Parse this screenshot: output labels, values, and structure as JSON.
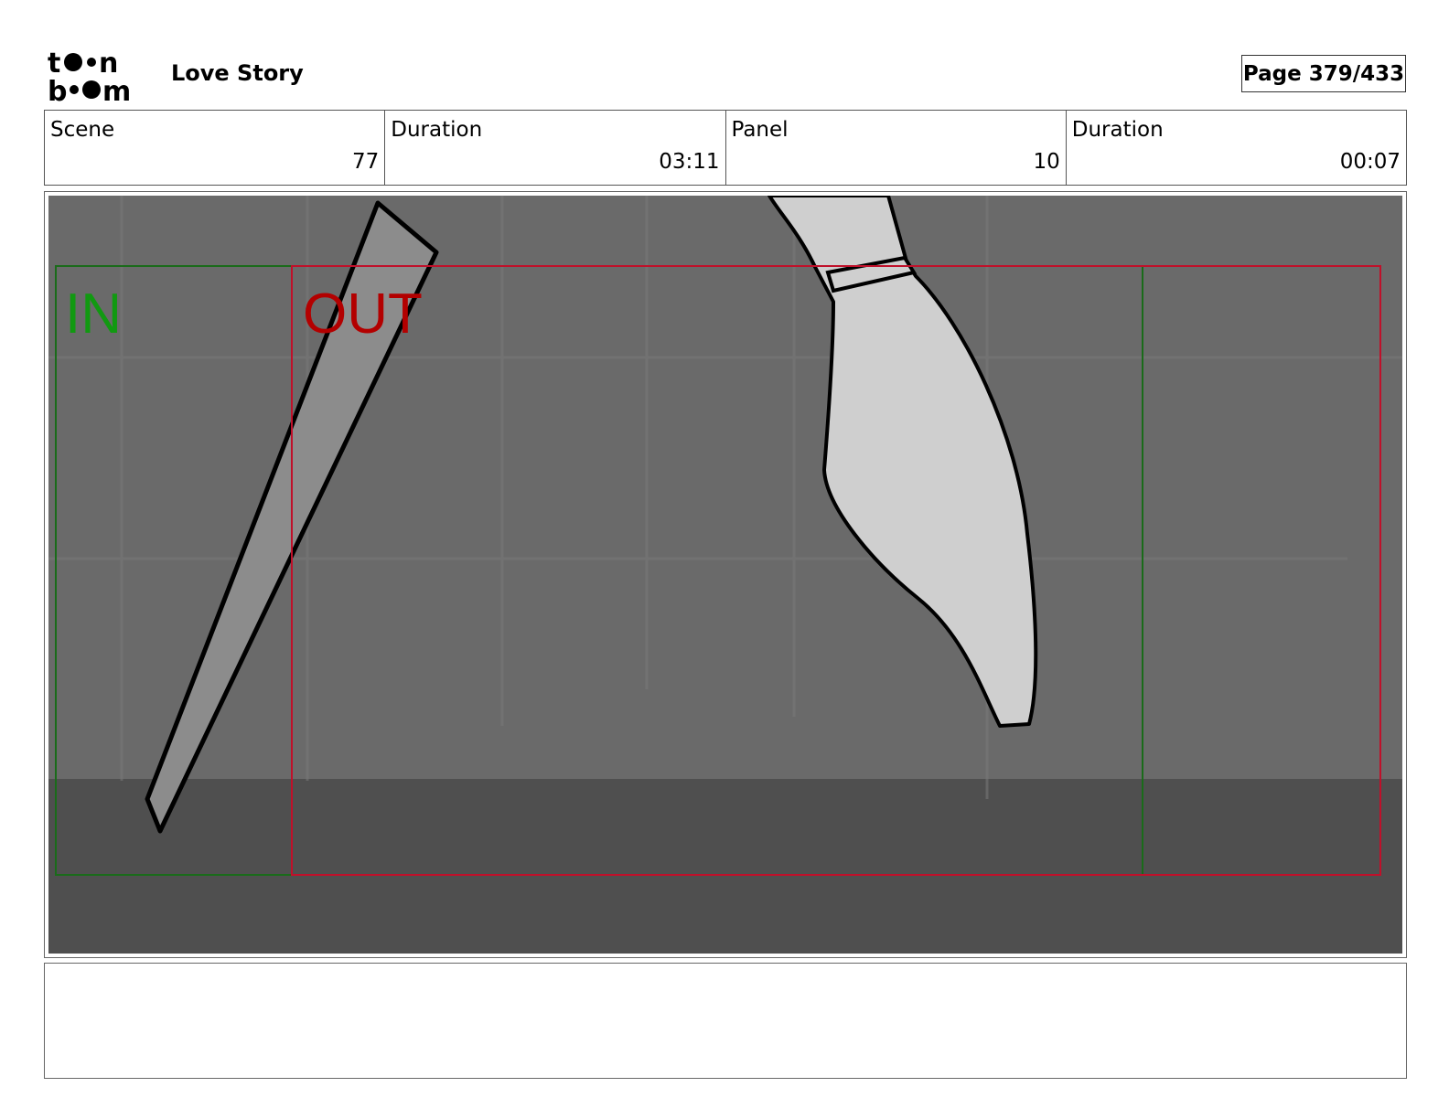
{
  "header": {
    "logo_text_top": "toon",
    "logo_text_bottom": "boom",
    "project_title": "Love Story",
    "page_label": "Page 379/433"
  },
  "info": {
    "scene_label": "Scene",
    "scene_value": "77",
    "scene_duration_label": "Duration",
    "scene_duration_value": "03:11",
    "panel_label": "Panel",
    "panel_value": "10",
    "panel_duration_label": "Duration",
    "panel_duration_value": "00:07"
  },
  "panel": {
    "in_label": "IN",
    "out_label": "OUT",
    "in_color": "#119911",
    "out_color": "#b30000",
    "frame_green": "#1a6b1a",
    "frame_red": "#c0102a",
    "background_wall": "#6a6a6a",
    "background_floor": "#4f4f4f",
    "sketch_fill_light": "#cfcfcf",
    "sketch_fill_mid": "#8c8c8c"
  },
  "notes": {
    "text": ""
  }
}
